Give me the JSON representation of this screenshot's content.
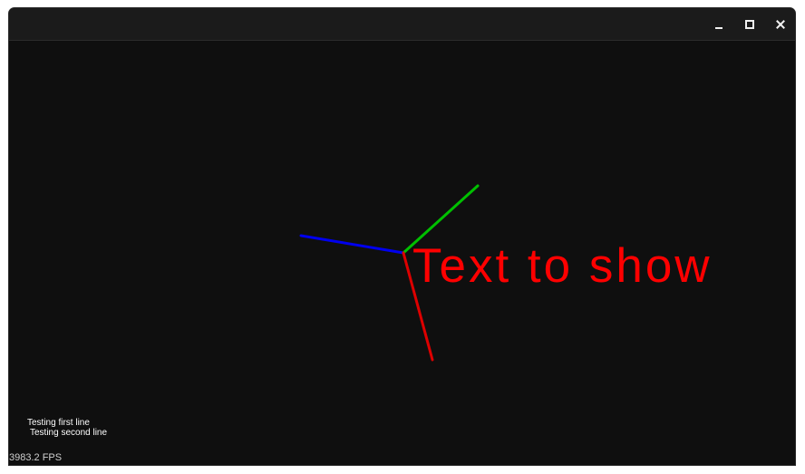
{
  "window": {
    "controls": {
      "minimize_icon": "minimize-icon",
      "maximize_icon": "maximize-icon",
      "close_icon": "close-icon"
    }
  },
  "scene": {
    "label_text": "Text to show",
    "label_color": "#ff0000",
    "axis_colors": {
      "x": "#0000ee",
      "y": "#00c000",
      "z": "#dd0000"
    }
  },
  "overlay": {
    "line1": "Testing first line",
    "line2": "Testing second line"
  },
  "status": {
    "fps": "3983.2 FPS"
  }
}
